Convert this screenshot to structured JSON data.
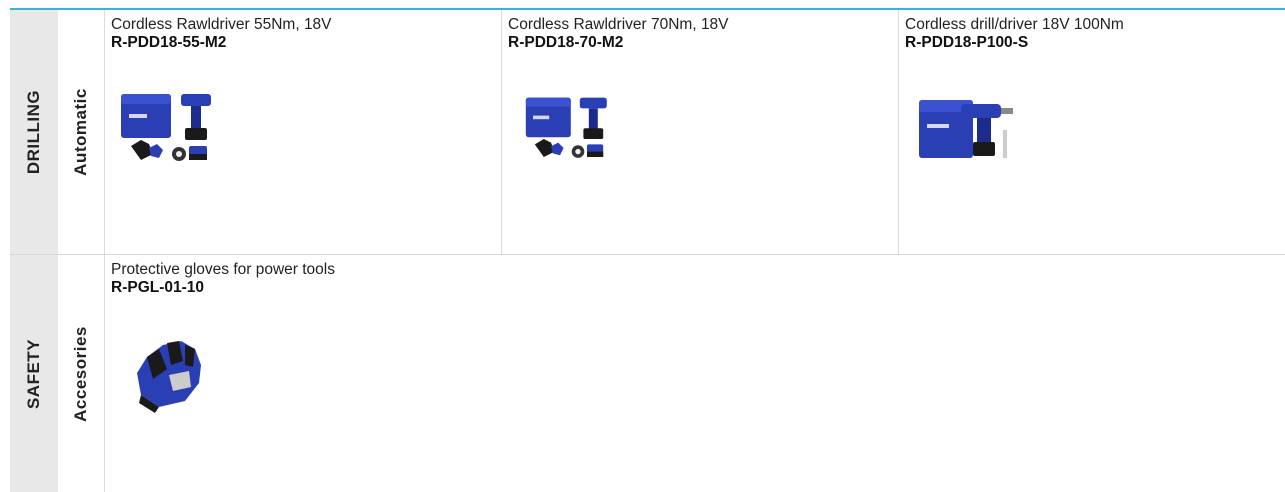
{
  "rows": [
    {
      "category": "DRILLING",
      "subcategory": "Automatic",
      "products": [
        {
          "name": "Cordless Rawldriver 55Nm, 18V",
          "code": "R-PDD18-55-M2",
          "image_icon": "drill-kit-image"
        },
        {
          "name": "Cordless Rawldriver 70Nm, 18V",
          "code": "R-PDD18-70-M2",
          "image_icon": "drill-kit-image"
        },
        {
          "name": "Cordless drill/driver 18V 100Nm",
          "code": "R-PDD18-P100-S",
          "image_icon": "drill-case-image"
        }
      ]
    },
    {
      "category": "SAFETY",
      "subcategory": "Accesories",
      "products": [
        {
          "name": "Protective gloves for power tools",
          "code": "R-PGL-01-10",
          "image_icon": "glove-image"
        }
      ]
    }
  ],
  "colors": {
    "accent": "#3fb3c8",
    "brand_blue": "#2b3fb5",
    "category_bg": "#e8e8e8"
  }
}
